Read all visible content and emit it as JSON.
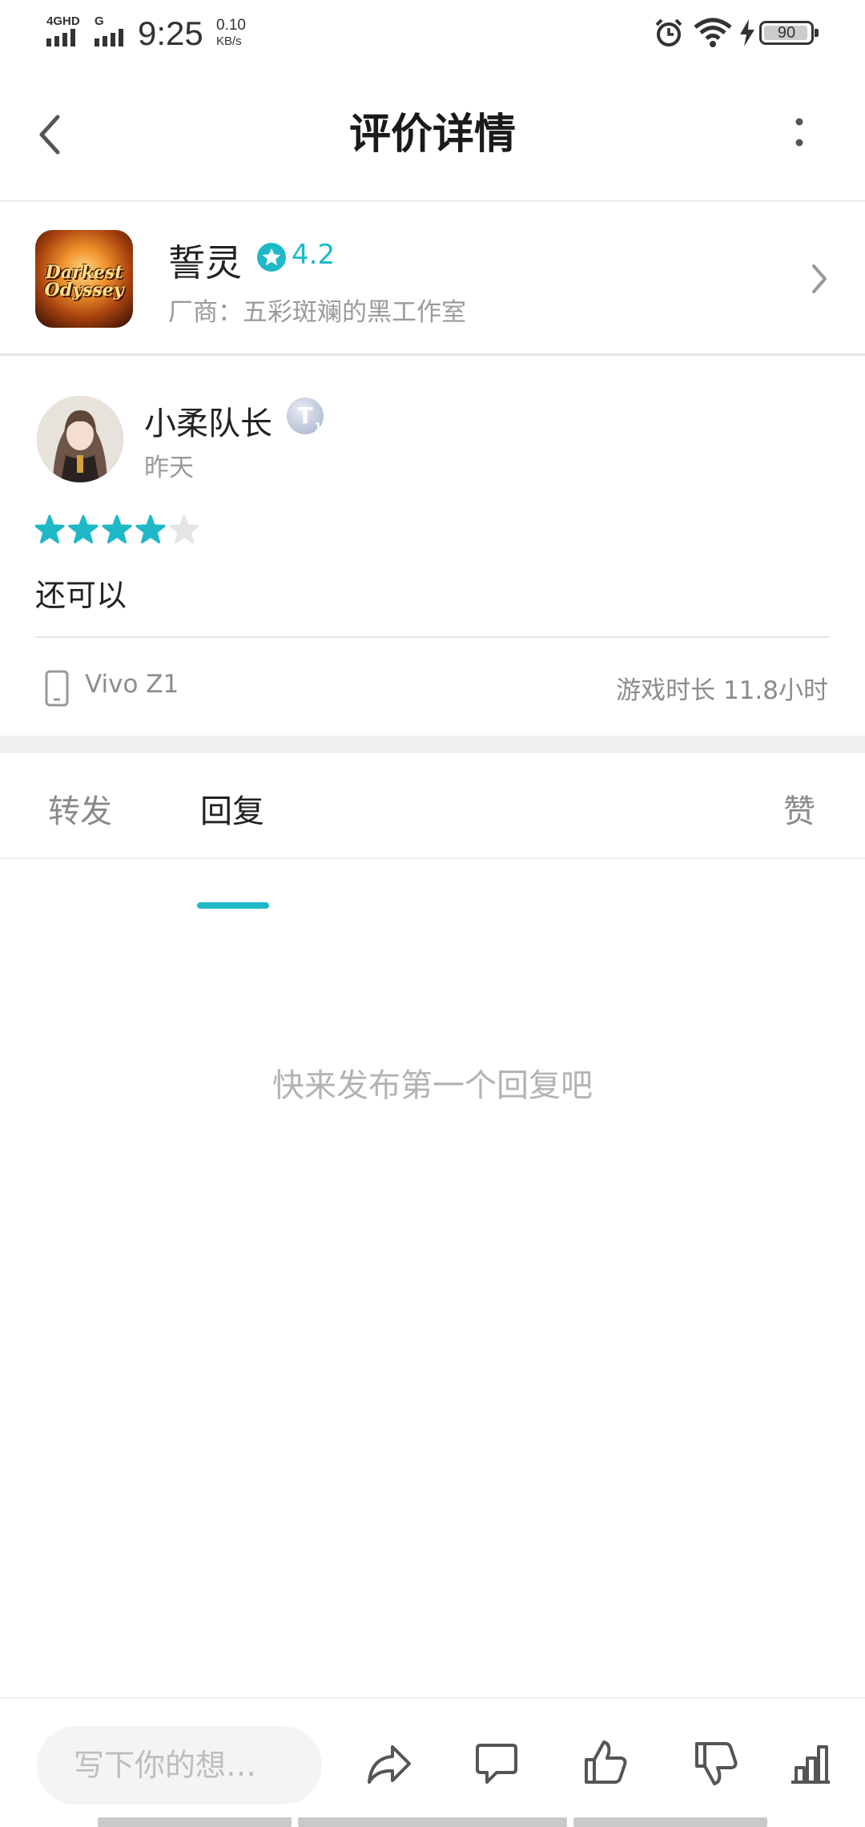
{
  "status_bar": {
    "network1": "4GHD",
    "network2": "G",
    "time": "9:25",
    "speed_value": "0.10",
    "speed_unit": "KB/s",
    "battery": "90"
  },
  "header": {
    "title": "评价详情"
  },
  "game": {
    "name": "誓灵",
    "rating": "4.2",
    "vendor": "厂商：五彩斑斓的黑工作室",
    "icon_text_line1": "Darkest",
    "icon_text_line2": "Odyssey"
  },
  "review": {
    "username": "小柔队长",
    "badge": "T",
    "badge_sub": "1",
    "date": "昨天",
    "stars_filled": 4,
    "stars_total": 5,
    "content": "还可以",
    "device": "Vivo Z1",
    "playtime": "游戏时长 11.8小时"
  },
  "tabs": {
    "forward": "转发",
    "reply": "回复",
    "like": "赞"
  },
  "empty_message": "快来发布第一个回复吧",
  "bottom_bar": {
    "input_placeholder": "写下你的想…"
  },
  "colors": {
    "accent": "#1fb8c7",
    "star_empty": "#e5e5e5",
    "muted_text": "#9a9a9a"
  }
}
